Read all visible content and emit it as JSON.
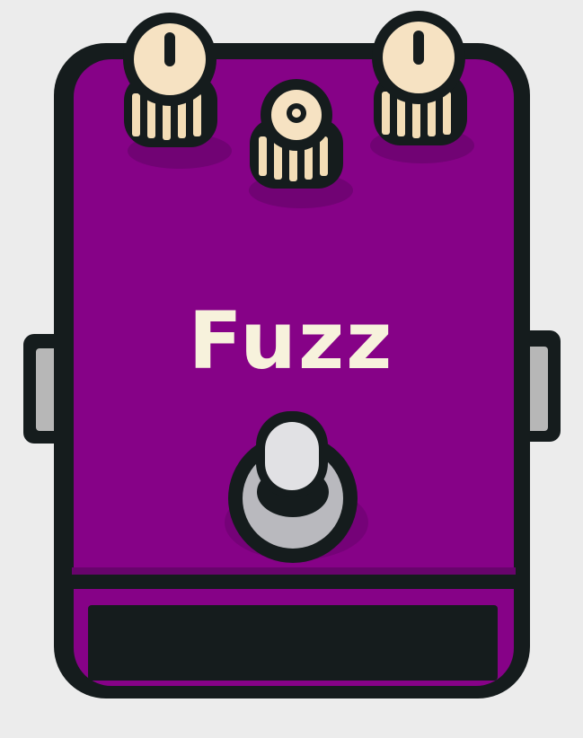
{
  "pedal": {
    "name": "Fuzz"
  },
  "colors": {
    "background": "#ececec",
    "outline": "#151c1d",
    "enclosure": "#860287",
    "enclosure_shadow": "#68046c",
    "label_text": "#f7f2dc",
    "knob_cream": "#f6e2c2",
    "knob_stripe": "#f3ddb6",
    "switch_light": "#e1e1e4",
    "switch_ring": "#b9b9be",
    "jack_gray": "#b7b7b7"
  },
  "icons": {
    "left_knob": "rotary-knob-icon",
    "center_knob": "rotary-knob-icon",
    "right_knob": "rotary-knob-icon",
    "footswitch": "footswitch-icon",
    "input_jack": "jack-icon",
    "output_jack": "jack-icon"
  }
}
